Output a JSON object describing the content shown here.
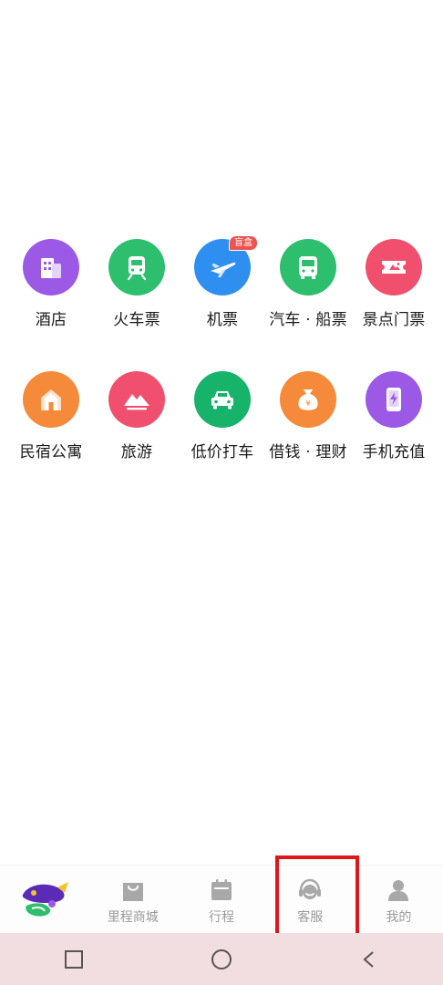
{
  "services": [
    [
      {
        "id": "hotel",
        "label": "酒店",
        "icon": "hotel-building-icon",
        "color": "#9b59e6"
      },
      {
        "id": "train",
        "label": "火车票",
        "icon": "train-icon",
        "color": "#2ebf6e"
      },
      {
        "id": "flight",
        "label": "机票",
        "icon": "airplane-icon",
        "color": "#2f8ff0",
        "badge": "盲盒"
      },
      {
        "id": "bus",
        "label": "汽车 · 船票",
        "icon": "bus-icon",
        "color": "#2ebf6e"
      },
      {
        "id": "ticket",
        "label": "景点门票",
        "icon": "ticket-icon",
        "color": "#f0506e"
      }
    ],
    [
      {
        "id": "homestay",
        "label": "民宿公寓",
        "icon": "house-icon",
        "color": "#f58a3a"
      },
      {
        "id": "travel",
        "label": "旅游",
        "icon": "mountain-icon",
        "color": "#f0506e"
      },
      {
        "id": "taxi",
        "label": "低价打车",
        "icon": "car-icon",
        "color": "#17b36b"
      },
      {
        "id": "finance",
        "label": "借钱 · 理财",
        "icon": "money-bag-icon",
        "color": "#f58a3a"
      },
      {
        "id": "recharge",
        "label": "手机充值",
        "icon": "phone-recharge-icon",
        "color": "#9b59e6"
      }
    ]
  ],
  "bottom_nav": {
    "home_icon": "fliggy-mascot-icon",
    "mall_label": "里程商城",
    "trips_label": "行程",
    "service_label": "客服",
    "mine_label": "我的"
  },
  "system_bar": {
    "recent": "square-icon",
    "home": "circle-icon",
    "back": "back-chevron-icon"
  },
  "colors": {
    "nav_icon": "#a8a8a8",
    "nav_text": "#9a9a9a",
    "highlight": "#e0161b"
  }
}
